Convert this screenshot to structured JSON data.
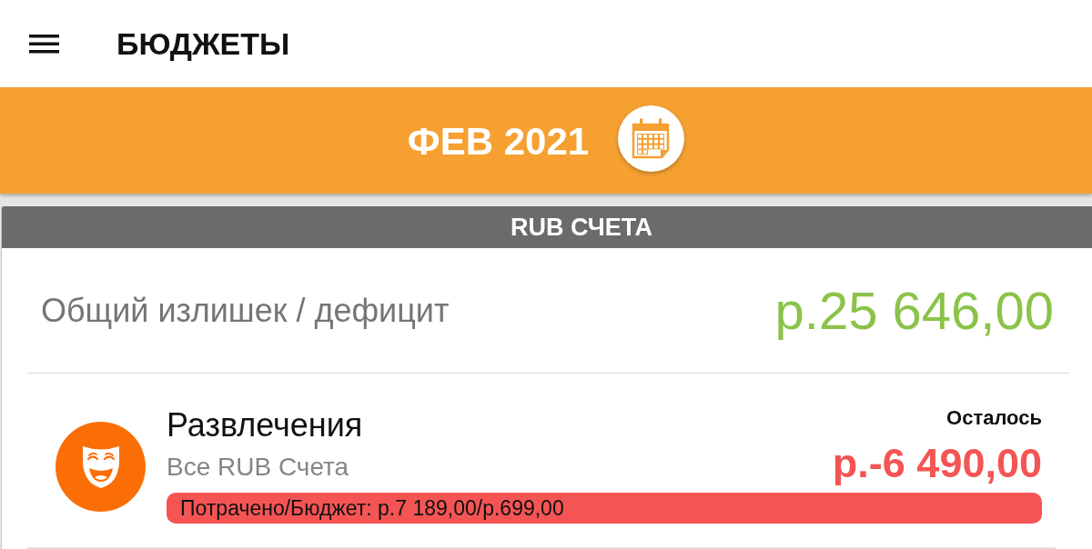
{
  "app_bar": {
    "title": "БЮДЖЕТЫ"
  },
  "period": {
    "label": "ФЕВ 2021"
  },
  "account_group": {
    "title": "RUB СЧЕТА",
    "summary": {
      "label": "Общий излишек / дефицит",
      "amount": "р.25 646,00"
    },
    "budgets": [
      {
        "name": "Развлечения",
        "accounts": "Все RUB Счета",
        "remaining_label": "Осталось",
        "remaining": "р.-6 490,00",
        "progress_text": "Потрачено/Бюджет: р.7 189,00/р.699,00",
        "overspent": true,
        "color": "#fb6e06"
      }
    ]
  }
}
